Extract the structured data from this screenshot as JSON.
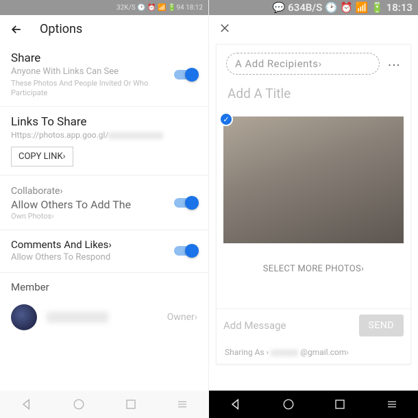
{
  "left": {
    "status": {
      "label": "32K/S 🕑 ⏰ 📶 🔋94 18:12"
    },
    "header": {
      "title": "Options"
    },
    "share": {
      "title": "Share",
      "sub": "Anyone With Links Can See",
      "desc": "These Photos And People Invited Or Who Participate"
    },
    "links": {
      "title": "Links To Share",
      "url": "Https://photos.app.goo.gl/",
      "copy": "COPY LINK›"
    },
    "collab": {
      "title": "Collaborate›",
      "sub": "Allow Others To Add The",
      "desc": "Own Photos›"
    },
    "comments": {
      "title": "Comments And Likes›",
      "sub": "Allow Others To Respond"
    },
    "member": {
      "title": "Member",
      "owner": "Owner›"
    }
  },
  "right": {
    "status": {
      "label": "💬  634B/S 🕑 ⏰ 📶 🔋 18:13"
    },
    "recipients": "A Add Recipients›",
    "title_ph": "Add A Title",
    "select_more": "SELECT MORE PHOTOS›",
    "msg_ph": "Add Message",
    "send": "SEND",
    "sharing_as": "Sharing As ›",
    "email": "@gmail.com›"
  }
}
